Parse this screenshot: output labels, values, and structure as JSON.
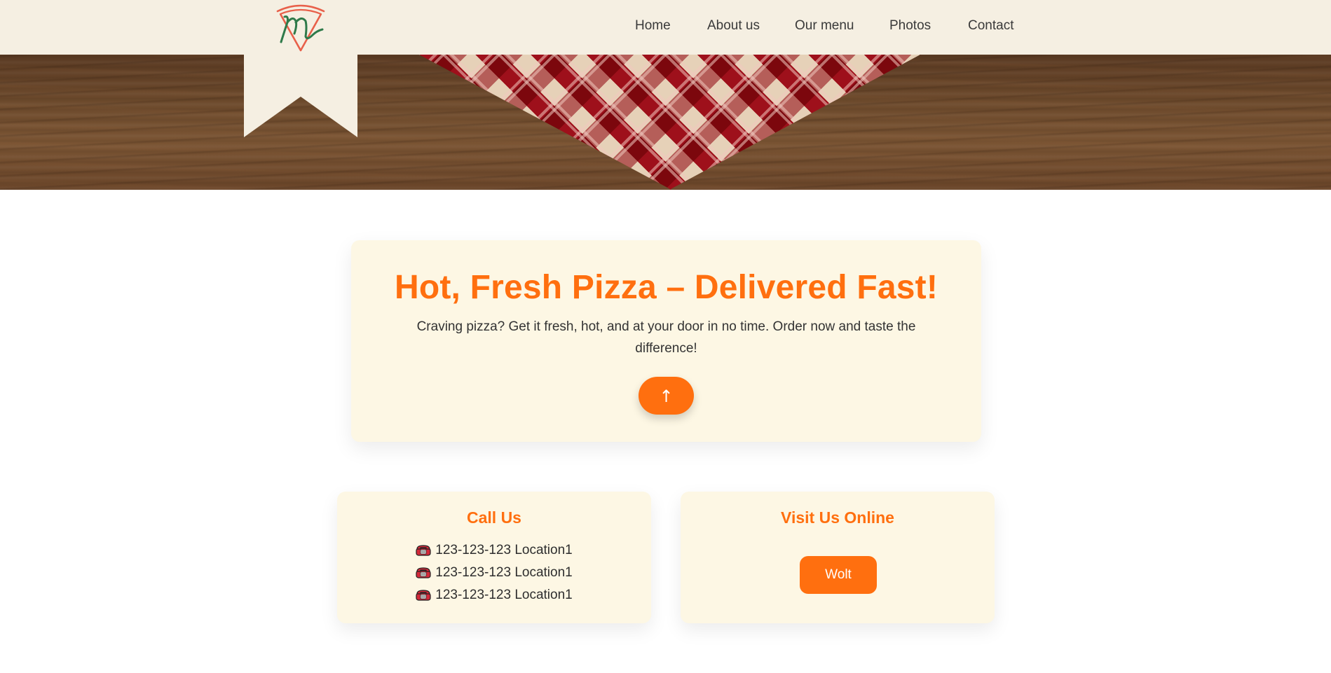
{
  "nav": {
    "items": [
      {
        "label": "Home"
      },
      {
        "label": "About us"
      },
      {
        "label": "Our menu"
      },
      {
        "label": "Photos"
      },
      {
        "label": "Contact"
      }
    ]
  },
  "hero": {
    "title": "Hot, Fresh Pizza – Delivered Fast!",
    "text": "Craving pizza? Get it fresh, hot, and at your door in no time. Order now and taste the difference!",
    "button_label": "↑"
  },
  "call": {
    "title": "Call Us",
    "phones": [
      {
        "text": "123-123-123 Location1"
      },
      {
        "text": "123-123-123 Location1"
      },
      {
        "text": "123-123-123 Location1"
      }
    ]
  },
  "visit": {
    "title": "Visit Us Online",
    "button_label": "Wolt"
  },
  "colors": {
    "accent": "#ff6f0f",
    "header_bg": "#f5efe2",
    "card_bg": "#fdf7e4"
  },
  "icons": {
    "logo": "pizza-slice-logo-icon",
    "phone": "telephone-icon"
  }
}
